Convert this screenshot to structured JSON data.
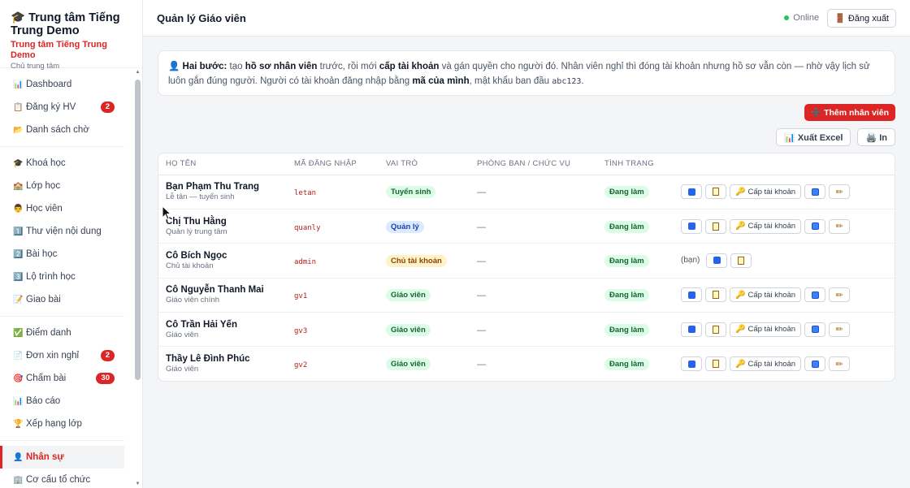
{
  "brand": {
    "title": "🎓 Trung tâm Tiếng Trung Demo",
    "subtitle": "Trung tâm Tiếng Trung Demo",
    "role": "Chủ trung tâm"
  },
  "sidebar": {
    "groups": [
      [
        {
          "icon": "📊",
          "label": "Dashboard"
        },
        {
          "icon": "📋",
          "label": "Đăng ký HV",
          "badge": "2"
        },
        {
          "icon": "📂",
          "label": "Danh sách chờ"
        }
      ],
      [
        {
          "icon": "🎓",
          "label": "Khoá học"
        },
        {
          "icon": "🏫",
          "label": "Lớp học"
        },
        {
          "icon": "👨",
          "label": "Học viên"
        },
        {
          "icon": "1️⃣",
          "label": "Thư viện nội dung"
        },
        {
          "icon": "2️⃣",
          "label": "Bài học"
        },
        {
          "icon": "3️⃣",
          "label": "Lộ trình học"
        },
        {
          "icon": "📝",
          "label": "Giao bài"
        }
      ],
      [
        {
          "icon": "✅",
          "label": "Điểm danh"
        },
        {
          "icon": "📄",
          "label": "Đơn xin nghỉ",
          "badge": "2"
        },
        {
          "icon": "🎯",
          "label": "Chấm bài",
          "badge": "30"
        },
        {
          "icon": "📊",
          "label": "Báo cáo"
        },
        {
          "icon": "🏆",
          "label": "Xếp hạng lớp"
        }
      ],
      [
        {
          "icon": "👤",
          "label": "Nhân sự",
          "active": true
        },
        {
          "icon": "🏢",
          "label": "Cơ cấu tổ chức"
        }
      ]
    ]
  },
  "header": {
    "title": "Quản lý Giáo viên",
    "status": "Online",
    "logout": "🚪 Đăng xuất"
  },
  "info": {
    "lead": "👤 Hai bước:",
    "t1": " tạo ",
    "b1": "hồ sơ nhân viên",
    "t2": " trước, rồi mới ",
    "b2": "cấp tài khoản",
    "t3": " và gán quyền cho người đó. Nhân viên nghỉ thì đóng tài khoản nhưng hồ sơ vẫn còn — nhờ vậy lịch sử luôn gắn đúng người. Người có tài khoản đăng nhập bằng ",
    "b3": "mã của mình",
    "t4": ", mật khẩu ban đầu ",
    "code": "abc123",
    "t5": "."
  },
  "toolbar": {
    "add": "➕ Thêm nhân viên",
    "export": "📊 Xuất Excel",
    "print": "🖨️ In"
  },
  "table": {
    "headers": [
      "HỌ TÊN",
      "MÃ ĐĂNG NHẬP",
      "VAI TRÒ",
      "PHÒNG BAN / CHỨC VỤ",
      "TÌNH TRẠNG"
    ],
    "grant_label": "Cấp tài khoản",
    "self_note": "(bạn)",
    "rows": [
      {
        "name": "Bạn Phạm Thu Trang",
        "sub": "Lễ tân — tuyển sinh",
        "login": "letan",
        "role": "Tuyển sinh",
        "role_style": "green",
        "dept": "—",
        "status": "Đang làm",
        "self": false
      },
      {
        "name": "Chị Thu Hằng",
        "sub": "Quản lý trung tâm",
        "login": "quanly",
        "role": "Quản lý",
        "role_style": "blue",
        "dept": "—",
        "status": "Đang làm",
        "self": false
      },
      {
        "name": "Cô Bích Ngọc",
        "sub": "Chủ tài khoản",
        "login": "admin",
        "role": "Chủ tài khoản",
        "role_style": "yellow",
        "dept": "—",
        "status": "Đang làm",
        "self": true
      },
      {
        "name": "Cô Nguyễn Thanh Mai",
        "sub": "Giáo viên chính",
        "login": "gv1",
        "role": "Giáo viên",
        "role_style": "green",
        "dept": "—",
        "status": "Đang làm",
        "self": false
      },
      {
        "name": "Cô Trần Hải Yến",
        "sub": "Giáo viên",
        "login": "gv3",
        "role": "Giáo viên",
        "role_style": "green",
        "dept": "—",
        "status": "Đang làm",
        "self": false
      },
      {
        "name": "Thầy Lê Đình Phúc",
        "sub": "Giáo viên",
        "login": "gv2",
        "role": "Giáo viên",
        "role_style": "green",
        "dept": "—",
        "status": "Đang làm",
        "self": false
      }
    ]
  }
}
